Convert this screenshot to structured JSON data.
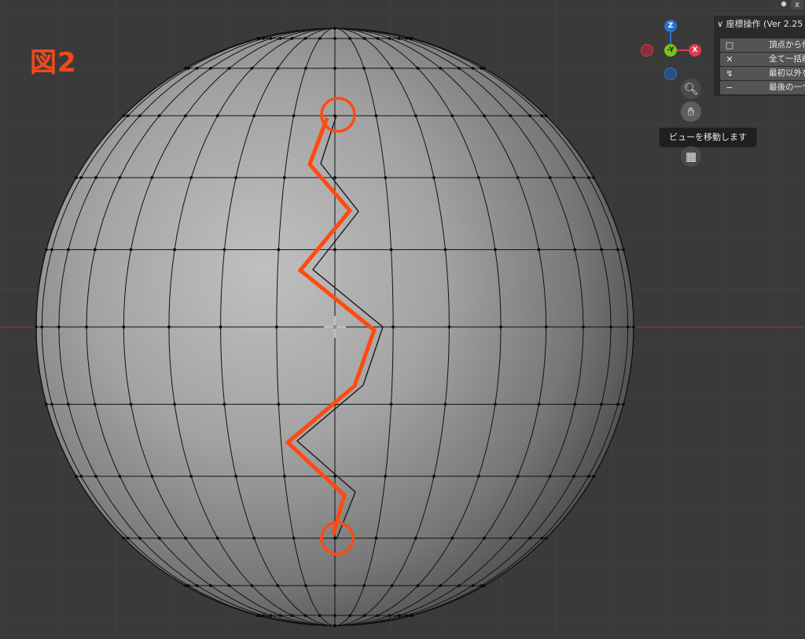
{
  "figure_label": "図2",
  "gizmo": {
    "z": "Z",
    "neg_y": "-Y",
    "x": "X",
    "colors": {
      "z": "#2d6fd1",
      "y": "#7cc31d",
      "x": "#dd3b4f",
      "neg_x": "#8c2f3c",
      "neg_z": "#2a4f80"
    }
  },
  "nav": {
    "zoom_icon": "zoom-icon",
    "hand_icon": "hand-icon",
    "grid_icon": "grid-icon",
    "tooltip": "ビューを移動します"
  },
  "panel": {
    "header": "座標操作 (Ver 2.25 P",
    "rows": [
      {
        "icon": "vertex-icon",
        "label": "頂点から作"
      },
      {
        "icon": "x-icon",
        "label": "全て一括削"
      },
      {
        "icon": "curve-arrow-icon",
        "label": "最初以外を"
      },
      {
        "icon": "minus-icon",
        "label": "最後の一つ"
      }
    ]
  },
  "colors": {
    "accent": "#ff4a10",
    "background": "#3a3a3a",
    "mesh_edge": "#000000"
  }
}
